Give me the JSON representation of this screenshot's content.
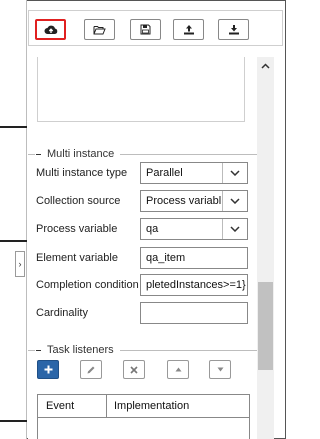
{
  "toolbar": {
    "buttons": [
      {
        "icon": "cloud-upload-icon",
        "label": "",
        "active": true
      },
      {
        "icon": "folder-open-icon",
        "label": ""
      },
      {
        "icon": "save-icon",
        "label": ""
      },
      {
        "icon": "upload-icon",
        "label": ""
      },
      {
        "icon": "download-icon",
        "label": ""
      }
    ],
    "active_color": "#e02020"
  },
  "multi_instance": {
    "section_title": "Multi instance",
    "rows": [
      {
        "label": "Multi instance type",
        "type": "select",
        "value": "Parallel"
      },
      {
        "label": "Collection source",
        "type": "select",
        "value": "Process variable"
      },
      {
        "label": "Process variable",
        "type": "select",
        "value": "qa"
      },
      {
        "label": "Element variable",
        "type": "text",
        "value": "qa_item"
      },
      {
        "label": "Completion condition",
        "type": "text",
        "value": "pletedInstances>=1}"
      },
      {
        "label": "Cardinality",
        "type": "text",
        "value": ""
      }
    ]
  },
  "task_listeners": {
    "section_title": "Task listeners",
    "actions": [
      {
        "icon": "plus-icon",
        "primary": true
      },
      {
        "icon": "pencil-icon"
      },
      {
        "icon": "times-icon"
      },
      {
        "icon": "caret-up-icon"
      },
      {
        "icon": "caret-down-icon"
      }
    ],
    "columns": [
      "Event",
      "Implementation"
    ],
    "primary_color": "#2a65a8"
  }
}
